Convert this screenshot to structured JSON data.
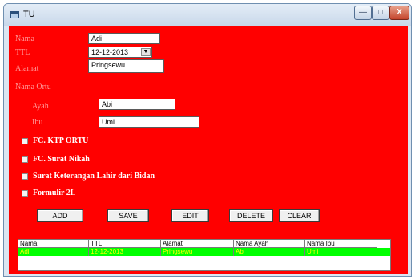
{
  "window": {
    "title": "TU",
    "min_label": "—",
    "max_label": "□",
    "close_label": "X"
  },
  "form": {
    "nama_label": "Nama",
    "nama_value": "Adi",
    "ttl_label": "TTL",
    "ttl_value": "12-12-2013",
    "alamat_label": "Alamat",
    "alamat_value": "Pringsewu",
    "nama_ortu_label": "Nama Ortu",
    "ayah_label": "Ayah",
    "ayah_value": "Abi",
    "ibu_label": "Ibu",
    "ibu_value": "Umi"
  },
  "checkboxes": [
    {
      "label": "FC. KTP ORTU"
    },
    {
      "label": "FC. Surat Nikah"
    },
    {
      "label": "Surat Keterangan Lahir dari Bidan"
    },
    {
      "label": "Formulir 2L"
    }
  ],
  "buttons": {
    "add": "ADD",
    "save": "SAVE",
    "edit": "EDIT",
    "delete": "DELETE",
    "clear": "CLEAR"
  },
  "grid": {
    "columns": [
      "Nama",
      "TTL",
      "Alamat",
      "Nama Ayah",
      "Nama Ibu"
    ],
    "rows": [
      [
        "Adi",
        "12-12-2013",
        "Pringsewu",
        "Abi",
        "Umi"
      ]
    ]
  },
  "colors": {
    "form_bg": "#ff0000",
    "row_highlight": "#00ff00",
    "row_text": "#ffff00"
  }
}
